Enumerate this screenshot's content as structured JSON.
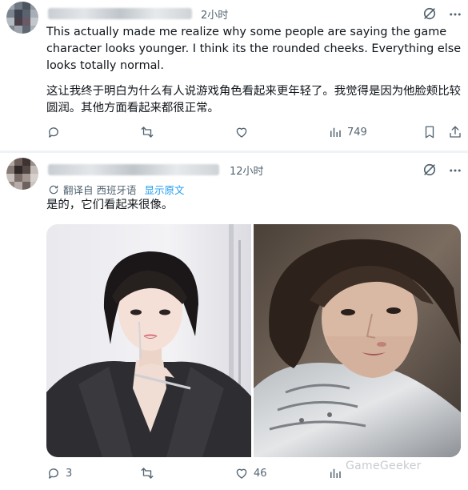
{
  "post1": {
    "time": "2小时",
    "text_en": "This actually made me realize why some people are saying the game character looks younger. I think its the rounded cheeks. Everything else looks totally normal.",
    "text_zh": "这让我终于明白为什么有人说游戏角色看起来更年轻了。我觉得是因为他脸颊比较圆润。其他方面看起来都很正常。",
    "views": "749"
  },
  "post2": {
    "time": "12小时",
    "translated_from": "翻译自 西班牙语",
    "show_original": "显示原文",
    "text": "是的，它们看起来很像。",
    "replies": "3",
    "likes": "46"
  },
  "watermark": "GameGeeker",
  "colors": {
    "text": "#0f1419",
    "muted": "#536471",
    "link": "#1d9bf0",
    "divider": "#eff3f4"
  }
}
